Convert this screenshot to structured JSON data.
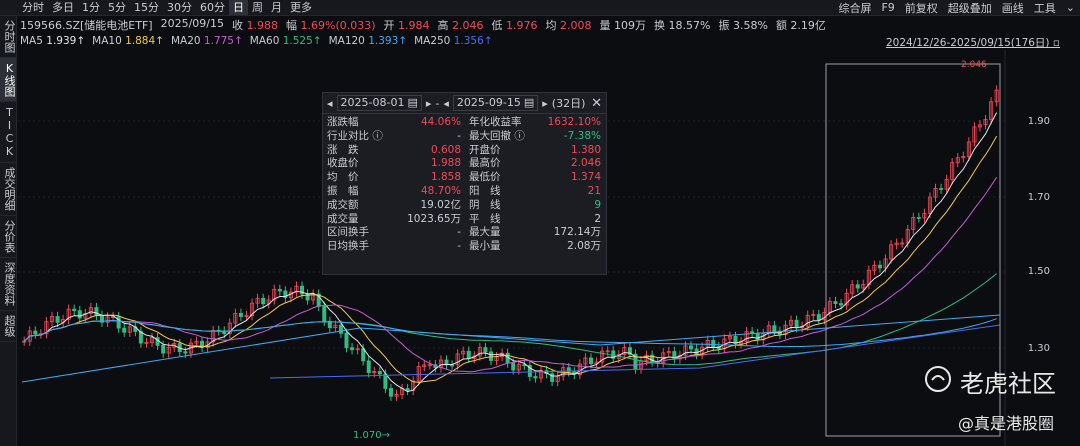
{
  "toolbar": {
    "tabs": [
      "分时",
      "多日",
      "1分",
      "5分",
      "15分",
      "30分",
      "60分",
      "日",
      "周",
      "月",
      "更多"
    ],
    "active_tab": "日",
    "right_items": [
      "综合屏",
      "F9",
      "前复权",
      "超级叠加",
      "画线",
      "工具"
    ]
  },
  "sidebar": {
    "items": [
      "分时图",
      "K线图",
      "TICK",
      "成交明细",
      "分价表",
      "深度资料",
      "超级"
    ],
    "active": "K线图"
  },
  "quote": {
    "code_name": "159566.SZ[储能电池ETF]",
    "date": "2025/09/15",
    "close_label": "收",
    "close": "1.988",
    "change_label": "幅",
    "change": "1.69%(0.033)",
    "open_label": "开",
    "open": "1.984",
    "high_label": "高",
    "high": "2.046",
    "low_label": "低",
    "low": "1.976",
    "avg_label": "均",
    "avg": "2.008",
    "volume": "量 109万",
    "turnover": "换 18.57%",
    "amplitude": "振 3.58%",
    "amount": "额 2.19亿"
  },
  "ma": [
    {
      "label": "MA5",
      "value": "1.939↑",
      "color": "#e6e6e6"
    },
    {
      "label": "MA10",
      "value": "1.884↑",
      "color": "#f2c94c"
    },
    {
      "label": "MA20",
      "value": "1.775↑",
      "color": "#c65cd6"
    },
    {
      "label": "MA60",
      "value": "1.525↑",
      "color": "#2ebd85"
    },
    {
      "label": "MA120",
      "value": "1.393↑",
      "color": "#3fa9f5"
    },
    {
      "label": "MA250",
      "value": "1.356↑",
      "color": "#4a6cf0"
    }
  ],
  "range_label": "2024/12/26-2025/09/15(176日)",
  "popup": {
    "start_date": "2025-08-01",
    "end_date": "2025-09-15",
    "days": "(32日)",
    "rows": [
      {
        "l": "涨跌幅",
        "v": "44.06%",
        "vc": "red",
        "l2": "年化收益率",
        "v2": "1632.10%",
        "v2c": "red"
      },
      {
        "l": "行业对比 ⓘ",
        "v": "-",
        "vc": "",
        "l2": "最大回撤 ⓘ",
        "v2": "-7.38%",
        "v2c": "green"
      },
      {
        "l": "涨　跌",
        "v": "0.608",
        "vc": "red",
        "l2": "开盘价",
        "v2": "1.380",
        "v2c": "red"
      },
      {
        "l": "收盘价",
        "v": "1.988",
        "vc": "red",
        "l2": "最高价",
        "v2": "2.046",
        "v2c": "red"
      },
      {
        "l": "均　价",
        "v": "1.858",
        "vc": "red",
        "l2": "最低价",
        "v2": "1.374",
        "v2c": "red"
      },
      {
        "l": "振　幅",
        "v": "48.70%",
        "vc": "red",
        "l2": "阳　线",
        "v2": "21",
        "v2c": "red"
      },
      {
        "l": "成交额",
        "v": "19.02亿",
        "vc": "",
        "l2": "阴　线",
        "v2": "9",
        "v2c": "green"
      },
      {
        "l": "成交量",
        "v": "1023.65万",
        "vc": "",
        "l2": "平　线",
        "v2": "2",
        "v2c": ""
      },
      {
        "l": "区间换手",
        "v": "-",
        "vc": "",
        "l2": "最大量",
        "v2": "172.14万",
        "v2c": ""
      },
      {
        "l": "日均换手",
        "v": "-",
        "vc": "",
        "l2": "最小量",
        "v2": "2.08万",
        "v2c": ""
      }
    ]
  },
  "chart_data": {
    "type": "candlestick",
    "y_ticks": [
      "1.90",
      "1.70",
      "1.50",
      "1.30"
    ],
    "high_label": "2.046",
    "low_label": "1.070",
    "ylim": [
      1.06,
      2.08
    ]
  },
  "watermark": {
    "brand": "老虎社区",
    "credit": "@真是港股圈"
  },
  "colors": {
    "up": "#f24957",
    "down": "#2ebd85",
    "bg": "#0c0d10"
  }
}
